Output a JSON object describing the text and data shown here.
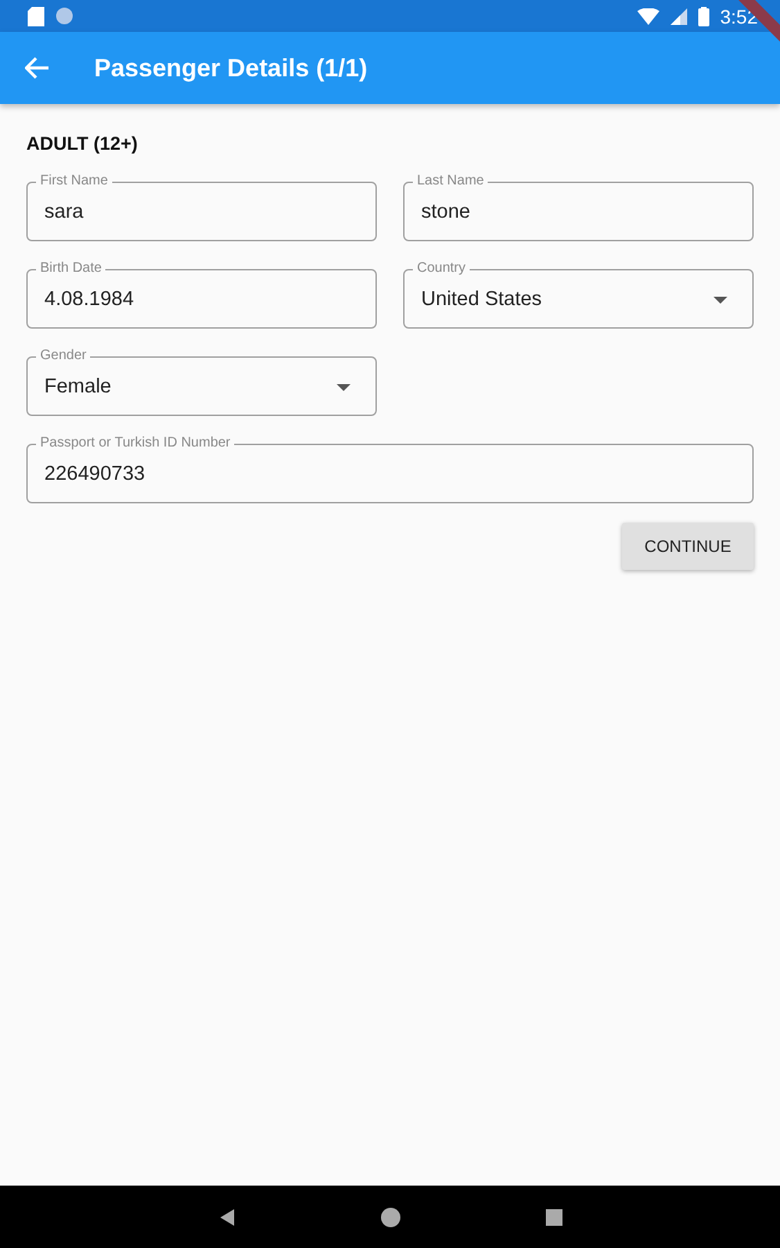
{
  "status_bar": {
    "time": "3:52"
  },
  "app_bar": {
    "title": "Passenger Details (1/1)"
  },
  "section": {
    "heading": "ADULT (12+)"
  },
  "form_rows": [
    [
      {
        "kind": "text",
        "label": "First Name",
        "value": "sara"
      },
      {
        "kind": "text",
        "label": "Last Name",
        "value": "stone"
      }
    ],
    [
      {
        "kind": "text",
        "label": "Birth Date",
        "value": "4.08.1984"
      },
      {
        "kind": "dropdown",
        "label": "Country",
        "value": "United States"
      }
    ],
    [
      {
        "kind": "dropdown",
        "label": "Gender",
        "value": "Female"
      }
    ],
    [
      {
        "kind": "wide",
        "label": "Passport or Turkish ID Number",
        "value": "226490733"
      }
    ]
  ],
  "buttons": [
    "CONTINUE"
  ]
}
